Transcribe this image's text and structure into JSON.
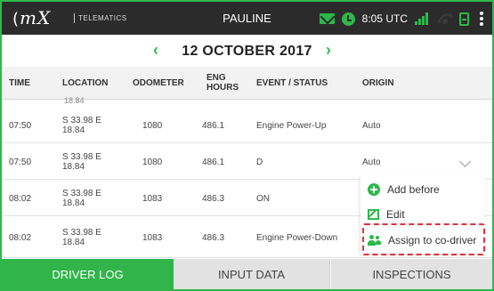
{
  "header": {
    "logo_text": "mX",
    "logo_left": "(",
    "brand_sub": "TELEMATICS",
    "driver_name": "PAULINE",
    "clock": "8:05 UTC"
  },
  "date_nav": {
    "prev": "‹",
    "date": "12 OCTOBER 2017",
    "next": "›"
  },
  "table": {
    "columns": {
      "time": "TIME",
      "location": "LOCATION",
      "odometer": "ODOMETER",
      "eng_hours_1": "ENG",
      "eng_hours_2": "HOURS",
      "event": "EVENT / STATUS",
      "origin": "ORIGIN"
    },
    "partial_row_text": "18.84",
    "rows": [
      {
        "time": "07:50",
        "loc1": "S 33.98 E",
        "loc2": "18.84",
        "odometer": "1080",
        "eng_hours": "486.1",
        "event": "Engine Power-Up",
        "origin": "Auto"
      },
      {
        "time": "07:50",
        "loc1": "S 33.98 E",
        "loc2": "18.84",
        "odometer": "1080",
        "eng_hours": "486.1",
        "event": "D",
        "origin": "Auto"
      },
      {
        "time": "08:02",
        "loc1": "S 33.98 E",
        "loc2": "18.84",
        "odometer": "1083",
        "eng_hours": "486.3",
        "event": "ON",
        "origin": ""
      },
      {
        "time": "08:02",
        "loc1": "S 33.98 E",
        "loc2": "18.84",
        "odometer": "1083",
        "eng_hours": "486.3",
        "event": "Engine Power-Down",
        "origin": ""
      }
    ]
  },
  "context_menu": {
    "add_before": "Add before",
    "edit": "Edit",
    "assign": "Assign to co-driver"
  },
  "tabs": {
    "driver_log": "DRIVER LOG",
    "input_data": "INPUT DATA",
    "inspections": "INSPECTIONS"
  },
  "colors": {
    "accent": "#2eb84a",
    "topbar": "#2b2b2b",
    "highlight": "#e0313d"
  }
}
